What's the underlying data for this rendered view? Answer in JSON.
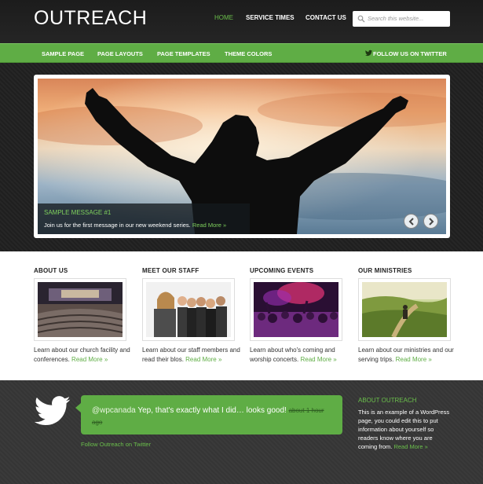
{
  "header": {
    "logo": "OUTREACH",
    "nav": [
      {
        "label": "HOME",
        "active": true
      },
      {
        "label": "SERVICE TIMES",
        "active": false
      },
      {
        "label": "CONTACT US",
        "active": false
      }
    ],
    "search_placeholder": "Search this website..."
  },
  "subnav": {
    "items": [
      "SAMPLE PAGE",
      "PAGE LAYOUTS",
      "PAGE TEMPLATES",
      "THEME COLORS"
    ],
    "twitter": "FOLLOW US ON TWITTER"
  },
  "slider": {
    "title": "SAMPLE MESSAGE #1",
    "text": "Join us for the first message in our new weekend series.",
    "read_more": "Read More »"
  },
  "features": [
    {
      "heading": "ABOUT US",
      "text": "Learn about our church facility and conferences.",
      "read_more": "Read More »"
    },
    {
      "heading": "MEET OUR STAFF",
      "text": "Learn about our staff members and read their blos.",
      "read_more": "Read More »"
    },
    {
      "heading": "UPCOMING EVENTS",
      "text": "Learn about who's coming and worship concerts.",
      "read_more": "Read More »"
    },
    {
      "heading": "OUR MINISTRIES",
      "text": "Learn about our ministries and our serving trips.",
      "read_more": "Read More »"
    }
  ],
  "footer": {
    "tweet_user": "@wpcanada",
    "tweet_text": "Yep, that's exactly what I did… looks good!",
    "tweet_time": "about 1 hour ago",
    "follow_link": "Follow Outreach on Twitter",
    "about_heading": "ABOUT OUTREACH",
    "about_text": "This is an example of a WordPress page, you could edit this to put information about yourself so readers know where you are coming from.",
    "about_more": "Read More »"
  },
  "colors": {
    "accent": "#5fad45",
    "dark": "#1e1e1e"
  }
}
